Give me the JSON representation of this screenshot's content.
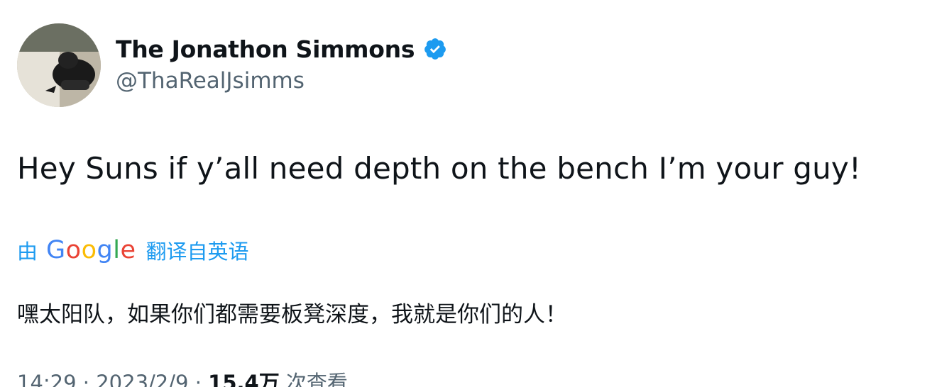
{
  "author": {
    "display_name": "The Jonathon Simmons",
    "handle": "@ThaRealJsimms",
    "verified": true
  },
  "tweet": {
    "text": "Hey Suns if y’all need depth on the bench I’m your guy!"
  },
  "translation": {
    "by_label": "由",
    "provider": "Google",
    "from_label": "翻译自英语",
    "translated_text": "嘿太阳队，如果你们都需要板凳深度，我就是你们的人！"
  },
  "meta": {
    "time": "14:29",
    "sep1": " · ",
    "date": "2023/2/9",
    "sep2": " · ",
    "views": "15.4万",
    "views_label": " 次查看"
  },
  "colors": {
    "accent": "#1d9bf0",
    "text": "#0f1419",
    "secondary": "#536471",
    "google_blue": "#4285f4",
    "google_red": "#ea4335",
    "google_yellow": "#fbbc05",
    "google_green": "#34a853"
  },
  "icons": {
    "verified": "verified-badge-icon",
    "avatar": "avatar-photo"
  }
}
